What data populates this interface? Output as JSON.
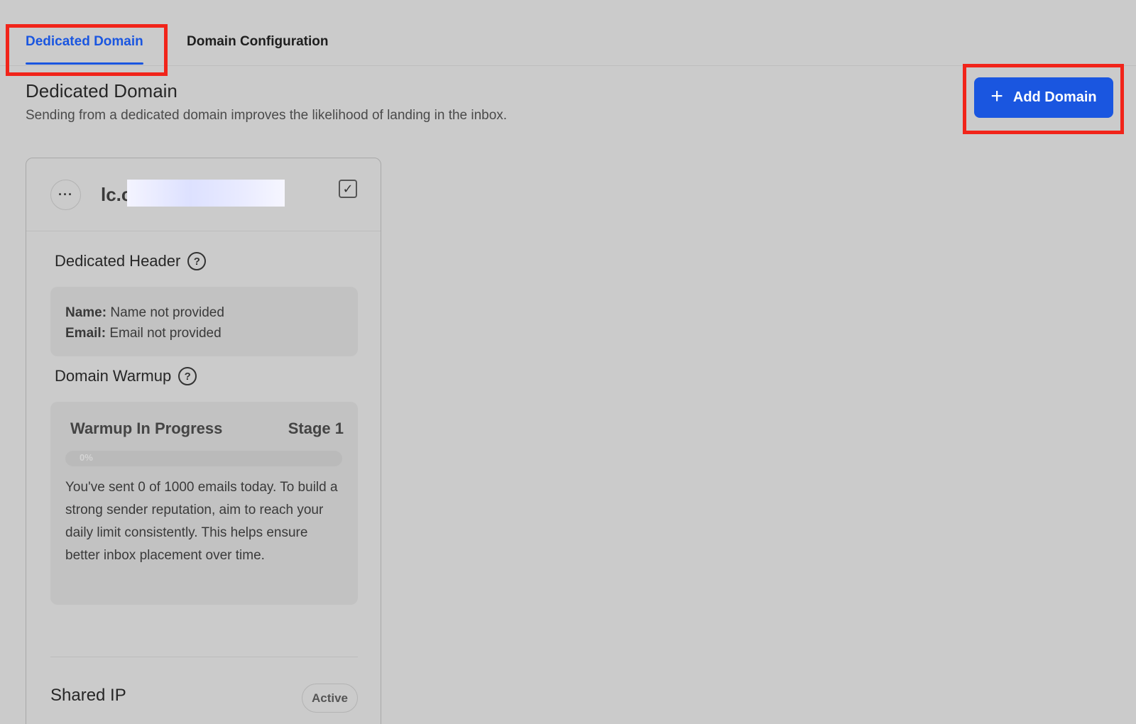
{
  "tabs": [
    {
      "label": "Dedicated Domain",
      "active": true
    },
    {
      "label": "Domain Configuration",
      "active": false
    }
  ],
  "header": {
    "title": "Dedicated Domain",
    "subtitle": "Sending from a dedicated domain improves the likelihood of landing in the inbox."
  },
  "actions": {
    "add_domain_label": "Add Domain",
    "add_icon": "plus-icon"
  },
  "domain_card": {
    "more_icon": "···",
    "domain_name": "lc.c n",
    "checked": true,
    "dedicated_header": {
      "title": "Dedicated Header",
      "name_label": "Name:",
      "name_value": "Name not provided",
      "email_label": "Email:",
      "email_value": "Email not provided"
    },
    "warmup": {
      "title": "Domain Warmup",
      "status": "Warmup In Progress",
      "stage": "Stage 1",
      "progress_percent": 0,
      "progress_label": "0%",
      "description": "You've sent 0 of 1000 emails today. To build a strong sender reputation, aim to reach your daily limit consistently. This helps ensure better inbox placement over time."
    },
    "ip": {
      "label": "Shared IP",
      "status": "Active"
    }
  },
  "colors": {
    "accent": "#1a56e0",
    "highlight": "#f1241a",
    "background": "#cbcbcb"
  }
}
